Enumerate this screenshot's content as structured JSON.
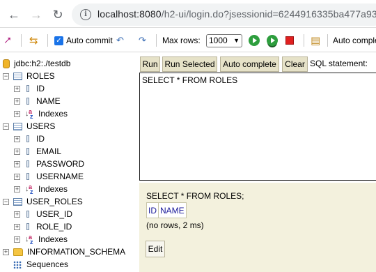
{
  "browser": {
    "url_host": "localhost:8080",
    "url_path": "/h2-ui/login.do?jsessionid=6244916335ba477a933"
  },
  "toolbar": {
    "auto_commit_label": "Auto commit",
    "auto_commit_checked": true,
    "max_rows_label": "Max rows:",
    "max_rows_value": "1000",
    "auto_complete_label": "Auto comple"
  },
  "tree": {
    "connection": "jdbc:h2:./testdb",
    "roles": {
      "name": "ROLES",
      "columns": [
        "ID",
        "NAME"
      ],
      "indexes": "Indexes"
    },
    "users": {
      "name": "USERS",
      "columns": [
        "ID",
        "EMAIL",
        "PASSWORD",
        "USERNAME"
      ],
      "indexes": "Indexes"
    },
    "user_roles": {
      "name": "USER_ROLES",
      "columns": [
        "USER_ID",
        "ROLE_ID"
      ],
      "indexes": "Indexes"
    },
    "information_schema": "INFORMATION_SCHEMA",
    "sequences": "Sequences"
  },
  "query_buttons": {
    "run": "Run",
    "run_selected": "Run Selected",
    "auto_complete": "Auto complete",
    "clear": "Clear",
    "statement_label": "SQL statement:"
  },
  "editor": {
    "sql": "SELECT * FROM ROLES"
  },
  "result": {
    "statement": "SELECT * FROM ROLES;",
    "columns": [
      "ID",
      "NAME"
    ],
    "summary": "(no rows, 2 ms)",
    "edit_label": "Edit"
  }
}
